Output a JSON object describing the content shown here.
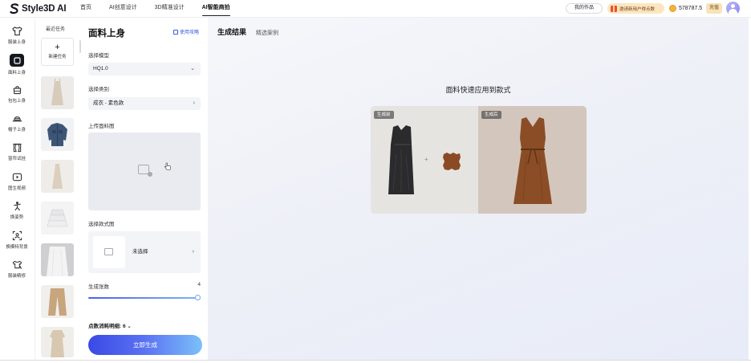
{
  "app": {
    "logo_text": "Style3D AI",
    "nav": [
      {
        "label": "首页"
      },
      {
        "label": "AI创意设计"
      },
      {
        "label": "3D精准设计"
      },
      {
        "label": "AI智能商拍"
      }
    ],
    "my_works_label": "我的作品",
    "promo_label": "邀请新用户得点数",
    "points_value": "578787.5",
    "recharge_label": "充值"
  },
  "sidebar": {
    "items": [
      {
        "label": "服装上身",
        "icon": "tshirt-icon"
      },
      {
        "label": "面料上身",
        "icon": "fabric-icon"
      },
      {
        "label": "包包上身",
        "icon": "bag-icon"
      },
      {
        "label": "帽子上身",
        "icon": "hat-icon"
      },
      {
        "label": "窗帘试挂",
        "icon": "curtain-icon"
      },
      {
        "label": "图生视频",
        "icon": "video-icon"
      },
      {
        "label": "换姿势",
        "icon": "pose-icon"
      },
      {
        "label": "换模特背景",
        "icon": "scan-icon"
      },
      {
        "label": "服装精修",
        "icon": "retouch-icon"
      }
    ]
  },
  "recent": {
    "title": "最近任务",
    "new_task_label": "新建任务"
  },
  "panel": {
    "title": "面料上身",
    "guide_label": "使用攻略",
    "model_label": "选择模型",
    "model_value": "HQ1.0",
    "category_label": "选择类别",
    "category_value": "成衣 - 素色款",
    "upload_label": "上传面料图",
    "style_label": "选择款式图",
    "style_value": "未选择",
    "count_label": "生成张数",
    "count_value": "4",
    "slider_fraction": 1.0,
    "cost_label": "点数消耗明细: 6",
    "generate_label": "立即生成"
  },
  "main": {
    "tabs": [
      {
        "label": "生成结果"
      },
      {
        "label": "精选案例"
      }
    ],
    "headline": "面料快速应用到款式",
    "before_tag": "生成前",
    "after_tag": "生成后",
    "plus": "+"
  },
  "colors": {
    "accent": "#3b5bdb",
    "generate_gradient_start": "#3a49e6",
    "generate_gradient_end": "#7cc0f9",
    "fabric_brown": "#8a4a24"
  }
}
